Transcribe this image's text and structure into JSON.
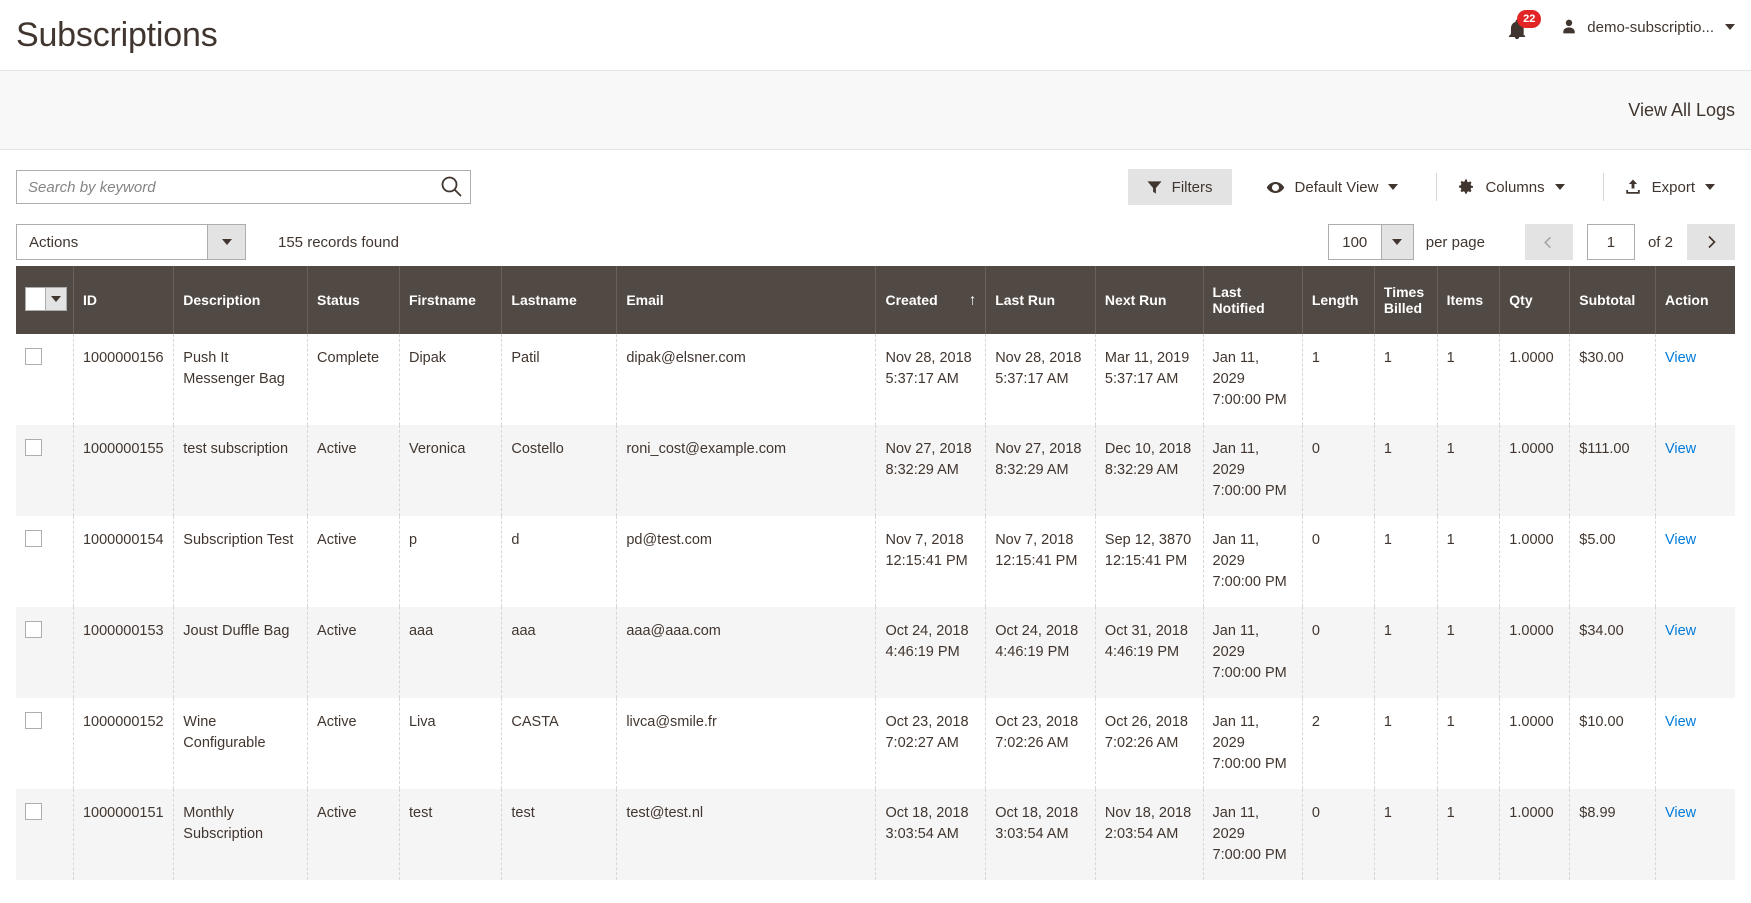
{
  "header": {
    "title": "Subscriptions",
    "notifications_count": "22",
    "user_name": "demo-subscriptio...",
    "bell_icon": "bell-icon",
    "user_icon": "user-icon",
    "caret_icon": "chevron-down-icon"
  },
  "subheader": {
    "view_all_logs": "View All Logs"
  },
  "toolbar": {
    "search_placeholder": "Search by keyword",
    "search_value": "",
    "search_icon": "search-icon",
    "filters_label": "Filters",
    "filters_icon": "funnel-icon",
    "default_view_label": "Default View",
    "default_view_icon": "eye-icon",
    "columns_label": "Columns",
    "columns_icon": "gear-icon",
    "export_label": "Export",
    "export_icon": "upload-icon"
  },
  "actions": {
    "actions_label": "Actions",
    "records_found": "155 records found"
  },
  "pagination": {
    "per_page_value": "100",
    "per_page_label": "per page",
    "prev_icon": "chevron-left-icon",
    "next_icon": "chevron-right-icon",
    "current_page": "1",
    "of_label": "of 2"
  },
  "grid": {
    "columns": [
      {
        "key": "check",
        "label": ""
      },
      {
        "key": "id",
        "label": "ID"
      },
      {
        "key": "desc",
        "label": "Description"
      },
      {
        "key": "status",
        "label": "Status"
      },
      {
        "key": "first",
        "label": "Firstname"
      },
      {
        "key": "last",
        "label": "Lastname"
      },
      {
        "key": "email",
        "label": "Email"
      },
      {
        "key": "created",
        "label": "Created"
      },
      {
        "key": "lastrun",
        "label": "Last Run"
      },
      {
        "key": "nextrun",
        "label": "Next Run"
      },
      {
        "key": "lastnot",
        "label": "Last Notified"
      },
      {
        "key": "length",
        "label": "Length"
      },
      {
        "key": "times",
        "label": "Times Billed"
      },
      {
        "key": "items",
        "label": "Items"
      },
      {
        "key": "qty",
        "label": "Qty"
      },
      {
        "key": "subtotal",
        "label": "Subtotal"
      },
      {
        "key": "action",
        "label": "Action"
      }
    ],
    "sort_column": "Created",
    "sort_direction": "↑",
    "action_link_label": "View",
    "rows": [
      {
        "id": "1000000156",
        "desc": "Push It Messenger Bag",
        "status": "Complete",
        "first": "Dipak",
        "last": "Patil",
        "email": "dipak@elsner.com",
        "created": "Nov 28, 2018 5:37:17 AM",
        "lastrun": "Nov 28, 2018 5:37:17 AM",
        "nextrun": "Mar 11, 2019 5:37:17 AM",
        "lastnot": "Jan 11, 2029 7:00:00 PM",
        "length": "1",
        "times": "1",
        "items": "1",
        "qty": "1.0000",
        "subtotal": "$30.00",
        "action": "View"
      },
      {
        "id": "1000000155",
        "desc": "test subscription",
        "status": "Active",
        "first": "Veronica",
        "last": "Costello",
        "email": "roni_cost@example.com",
        "created": "Nov 27, 2018 8:32:29 AM",
        "lastrun": "Nov 27, 2018 8:32:29 AM",
        "nextrun": "Dec 10, 2018 8:32:29 AM",
        "lastnot": "Jan 11, 2029 7:00:00 PM",
        "length": "0",
        "times": "1",
        "items": "1",
        "qty": "1.0000",
        "subtotal": "$111.00",
        "action": "View"
      },
      {
        "id": "1000000154",
        "desc": "Subscription Test",
        "status": "Active",
        "first": "p",
        "last": "d",
        "email": "pd@test.com",
        "created": "Nov 7, 2018 12:15:41 PM",
        "lastrun": "Nov 7, 2018 12:15:41 PM",
        "nextrun": "Sep 12, 3870 12:15:41 PM",
        "lastnot": "Jan 11, 2029 7:00:00 PM",
        "length": "0",
        "times": "1",
        "items": "1",
        "qty": "1.0000",
        "subtotal": "$5.00",
        "action": "View"
      },
      {
        "id": "1000000153",
        "desc": "Joust Duffle Bag",
        "status": "Active",
        "first": "aaa",
        "last": "aaa",
        "email": "aaa@aaa.com",
        "created": "Oct 24, 2018 4:46:19 PM",
        "lastrun": "Oct 24, 2018 4:46:19 PM",
        "nextrun": "Oct 31, 2018 4:46:19 PM",
        "lastnot": "Jan 11, 2029 7:00:00 PM",
        "length": "0",
        "times": "1",
        "items": "1",
        "qty": "1.0000",
        "subtotal": "$34.00",
        "action": "View"
      },
      {
        "id": "1000000152",
        "desc": "Wine Configurable",
        "status": "Active",
        "first": "Liva",
        "last": "CASTA",
        "email": "livca@smile.fr",
        "created": "Oct 23, 2018 7:02:27 AM",
        "lastrun": "Oct 23, 2018 7:02:26 AM",
        "nextrun": "Oct 26, 2018 7:02:26 AM",
        "lastnot": "Jan 11, 2029 7:00:00 PM",
        "length": "2",
        "times": "1",
        "items": "1",
        "qty": "1.0000",
        "subtotal": "$10.00",
        "action": "View"
      },
      {
        "id": "1000000151",
        "desc": "Monthly Subscription",
        "status": "Active",
        "first": "test",
        "last": "test",
        "email": "test@test.nl",
        "created": "Oct 18, 2018 3:03:54 AM",
        "lastrun": "Oct 18, 2018 3:03:54 AM",
        "nextrun": "Nov 18, 2018 2:03:54 AM",
        "lastnot": "Jan 11, 2029 7:00:00 PM",
        "length": "0",
        "times": "1",
        "items": "1",
        "qty": "1.0000",
        "subtotal": "$8.99",
        "action": "View"
      }
    ]
  },
  "colors": {
    "header_bg": "#514943",
    "accent_link": "#007bdb",
    "badge_red": "#e22626",
    "text": "#41362f"
  }
}
